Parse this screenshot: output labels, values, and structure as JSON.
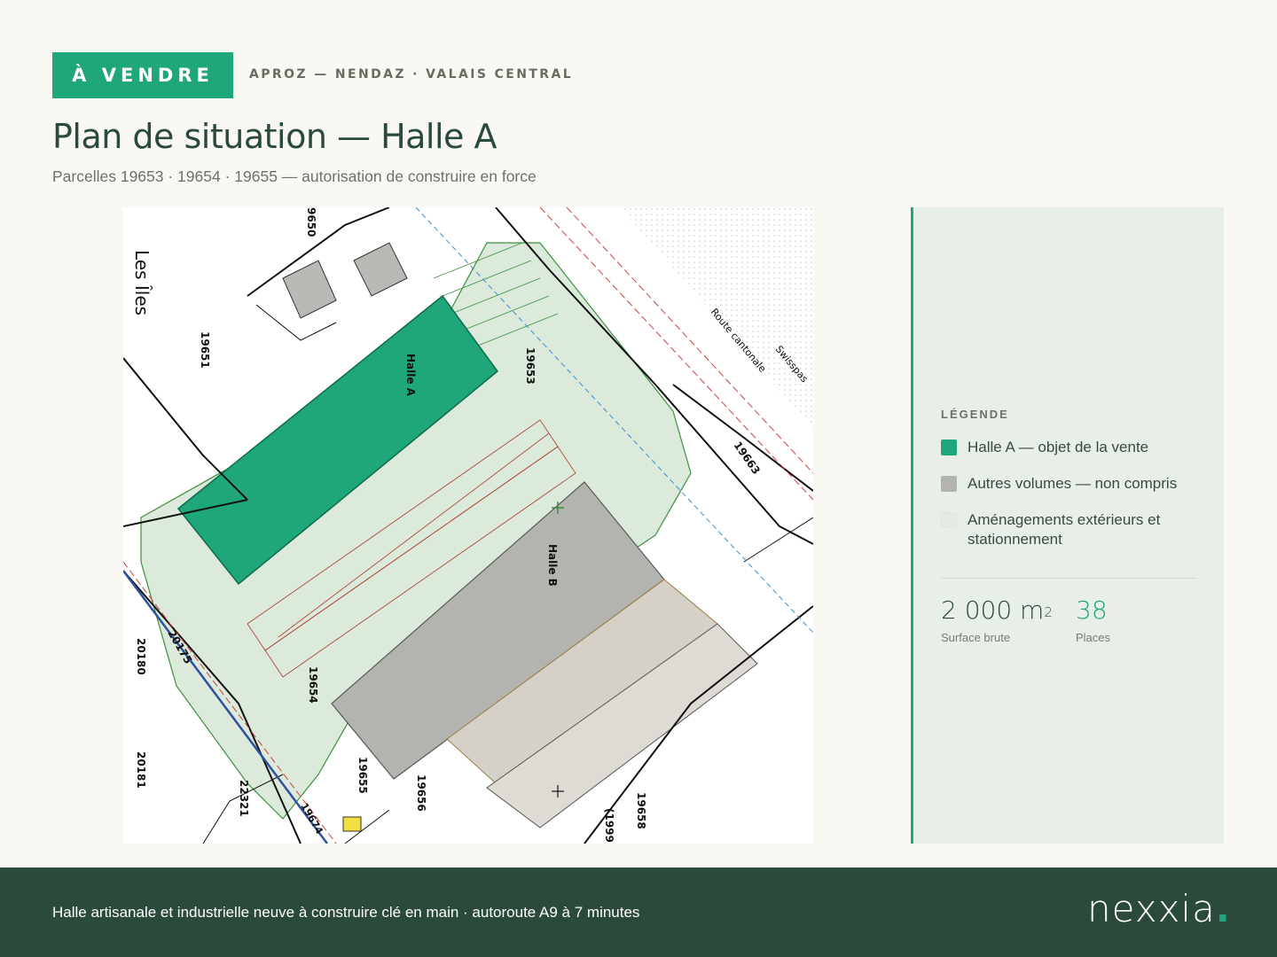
{
  "header": {
    "badge": "À VENDRE",
    "location": "APROZ — NENDAZ · VALAIS CENTRAL",
    "title": "Plan de situation — Halle A",
    "subtitle": "Parcelles 19653 · 19654 · 19655 — autorisation de construire en force"
  },
  "plan": {
    "labels": {
      "locality": "Les Îles",
      "halle_a": "Halle A",
      "halle_b": "Halle B",
      "road": "Route cantonale",
      "road2": "Swisspas",
      "parcels": [
        "9650",
        "19651",
        "19653",
        "19654",
        "19655",
        "19656",
        "19658",
        "19663",
        "19674",
        "20175",
        "20180",
        "20181",
        "22321",
        "(1999)"
      ]
    },
    "colors": {
      "halle_a": "#1fa67a",
      "other_volumes": "#b3b3b0",
      "exterior": "#dbeadb"
    }
  },
  "legend": {
    "title": "LÉGENDE",
    "items": [
      {
        "label": "Halle A — objet de la vente",
        "color": "#1fa67a"
      },
      {
        "label": "Autres volumes — non compris",
        "color": "#b3b3b0"
      },
      {
        "label": "Aménagements extérieurs et stationnement",
        "color": "#e3ebe4"
      }
    ]
  },
  "stats": {
    "surface_value": "2 000 m",
    "surface_exp": "2",
    "surface_label": "Surface brute",
    "places_value": "38",
    "places_label": "Places"
  },
  "footer": {
    "text": "Halle artisanale et industrielle neuve à construire clé en main · autoroute A9 à 7 minutes",
    "logo": "nexxia",
    "logo_dot": "."
  }
}
